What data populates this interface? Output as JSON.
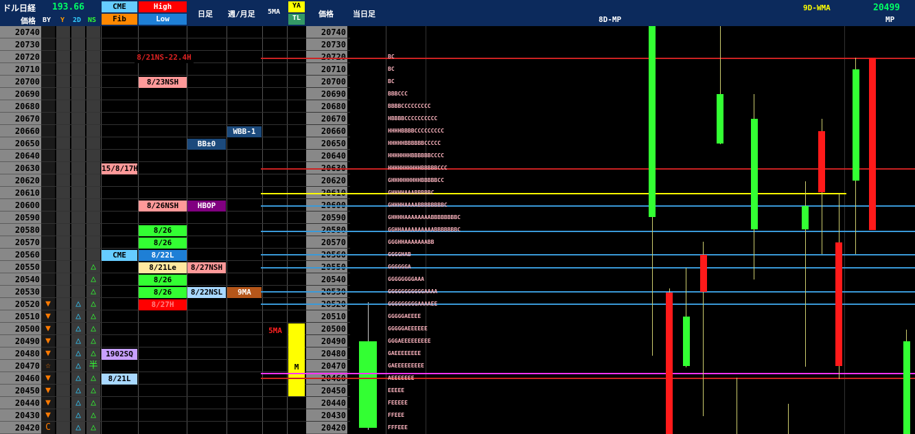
{
  "header": {
    "instrument": "ドル日経",
    "usdjpy": "193.66",
    "cme": "CME",
    "high": "High",
    "fib": "Fib",
    "low": "Low",
    "daily": "日足",
    "weekly_monthly": "週/月足",
    "ma5": "5MA",
    "ya": "YA",
    "tl": "TL",
    "price_label": "価格",
    "price_label_2": "価格",
    "today_bar": "当日足",
    "by": "BY",
    "y": "Y",
    "two_d": "2D",
    "ns": "NS",
    "mp_8d": "8D-MP",
    "wma_9d": "9D-WMA",
    "mp_value": "20499",
    "mp": "MP"
  },
  "prices": [
    "20740",
    "20730",
    "20720",
    "20710",
    "20700",
    "20690",
    "20680",
    "20670",
    "20660",
    "20650",
    "20640",
    "20630",
    "20620",
    "20610",
    "20600",
    "20590",
    "20580",
    "20570",
    "20560",
    "20550",
    "20540",
    "20530",
    "20520",
    "20510",
    "20500",
    "20490",
    "20480",
    "20470",
    "20460",
    "20450",
    "20440",
    "20430",
    "20420"
  ],
  "signals": {
    "by": [
      "",
      "",
      "",
      "",
      "",
      "",
      "",
      "",
      "",
      "",
      "",
      "",
      "",
      "",
      "",
      "",
      "",
      "",
      "",
      "",
      "",
      "",
      "▼",
      "▼",
      "▼",
      "▼",
      "▼",
      "☆",
      "▼",
      "▼",
      "▼",
      "▼",
      "C"
    ],
    "y": [
      "",
      "",
      "",
      "",
      "",
      "",
      "",
      "",
      "",
      "",
      "",
      "",
      "",
      "",
      "",
      "",
      "",
      "",
      "",
      "",
      "",
      "",
      "△",
      "△",
      "△",
      "△",
      "△",
      "△",
      "△",
      "△",
      "△",
      "△",
      "△"
    ],
    "ns": [
      "",
      "",
      "",
      "",
      "",
      "",
      "",
      "",
      "",
      "",
      "",
      "",
      "",
      "",
      "",
      "",
      "",
      "",
      "",
      "△",
      "△",
      "△",
      "△",
      "△",
      "△",
      "△",
      "△",
      "半",
      "△",
      "△",
      "△",
      "△",
      "△"
    ]
  },
  "labels": {
    "cme_high_top": "8/21NS-22.4H",
    "h_8_23nsh": "8/23NSH",
    "wbb": "WBB-1",
    "bb0": "BB±0",
    "h_15_8_17h": "15/8/17H",
    "h_8_26nsh": "8/26NSH",
    "hbop": "HBOP",
    "h_8_26a": "8/26",
    "h_8_26b": "8/26",
    "cme_mid": "CME",
    "l_8_22l": "8/22L",
    "l_8_21le": "8/21Le",
    "h_8_27nsh": "8/27NSH",
    "h_8_26c": "8/26",
    "h_8_26d": "8/26",
    "l_8_22nsl": "8/22NSL",
    "ma9": "9MA",
    "h_8_27h": "8/27H",
    "ma5_label": "5MA",
    "sq": "1902SQ",
    "ya_m": "M",
    "l_8_21l": "8/21L"
  },
  "tpo_rows": [
    "BC",
    "BC",
    "BC",
    "BBBCCC",
    "BBBBCCCCCCCCC",
    "HBBBBCCCCCCCCCC",
    "HHHHBBBBCCCCCCCCC",
    "HHHHHBBBBBBCCCCC",
    "HHHHHHHBBBBBBCCCC",
    "HHHHHHHHHHBBBBBCCC",
    "GHHHHHHHHHBBBBBCC",
    "GHHHHAAABBBBBC",
    "GHHHHAAAABBBBBBBBC",
    "GHHHHAAAAAAAABBBBBBBBC",
    "GGHHAAAAAAAAAABBBBBBBC",
    "GGGHHAAAAAAABB",
    "GGGGHAB",
    "GGGGGGA",
    "GGGGGGGGAAA",
    "GGGGGGGGGGGAAAA",
    "GGGGGGGGGAAAAEE",
    "GGGGGAEEEE",
    "GGGGGAEEEEEE",
    "GGGAEEEEEEEEE",
    "GAEEEEEEEE",
    "GAEEEEEEEEE",
    "AEEEEEEE",
    "EEEEE",
    "FEEEEE",
    "FFEEE",
    "FFFEEE"
  ],
  "colors": {
    "accent_red": "#ff2020",
    "accent_green": "#33ff33",
    "yellow": "#ffff00",
    "blue_line": "#3a9ad9",
    "magenta_line": "#ff33ff",
    "pink_tpo": "#ffb6c1"
  }
}
